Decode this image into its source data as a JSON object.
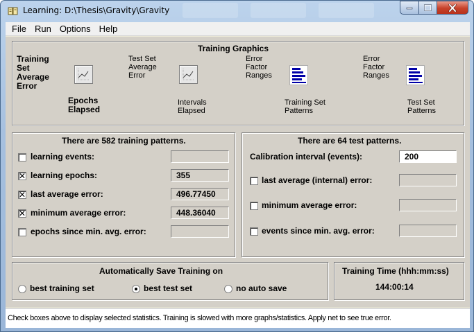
{
  "window": {
    "title": "Learning: D:\\Thesis\\Gravity\\Gravity",
    "icon": "book-icon"
  },
  "menu": [
    "File",
    "Run",
    "Options",
    "Help"
  ],
  "graphics": {
    "title": "Training Graphics",
    "training_set_average_error": {
      "line1": "Training",
      "line2": "Set",
      "line3": "Average",
      "line4": "Error"
    },
    "epochs_elapsed": {
      "line1": "Epochs",
      "line2": "Elapsed"
    },
    "test_set_average_error": {
      "line1": "Test Set",
      "line2": "Average",
      "line3": "Error"
    },
    "intervals_elapsed": {
      "line1": "Intervals",
      "line2": "Elapsed"
    },
    "error_factor_ranges_training": {
      "line1": "Error",
      "line2": "Factor",
      "line3": "Ranges"
    },
    "training_set_patterns": {
      "line1": "Training Set",
      "line2": "Patterns"
    },
    "error_factor_ranges_test": {
      "line1": "Error",
      "line2": "Factor",
      "line3": "Ranges"
    },
    "test_set_patterns": {
      "line1": "Test Set",
      "line2": "Patterns"
    }
  },
  "training": {
    "header": "There are 582 training patterns.",
    "rows": [
      {
        "label": "learning events:",
        "checked": false,
        "value": ""
      },
      {
        "label": "learning epochs:",
        "checked": true,
        "value": "355"
      },
      {
        "label": "last average error:",
        "checked": true,
        "value": "496.77450"
      },
      {
        "label": "minimum average error:",
        "checked": true,
        "value": "448.36040"
      },
      {
        "label": "epochs since min. avg. error:",
        "checked": false,
        "value": ""
      }
    ]
  },
  "test": {
    "header": "There are 64 test patterns.",
    "calibration_label": "Calibration interval (events):",
    "calibration_value": "200",
    "rows": [
      {
        "label": "last average (internal) error:",
        "checked": false,
        "value": ""
      },
      {
        "label": "minimum average error:",
        "checked": false,
        "value": ""
      },
      {
        "label": "events since min. avg. error:",
        "checked": false,
        "value": ""
      }
    ]
  },
  "autosave": {
    "title": "Automatically Save Training on",
    "options": [
      {
        "label": "best training set",
        "selected": false
      },
      {
        "label": "best test set",
        "selected": true
      },
      {
        "label": "no auto save",
        "selected": false
      }
    ]
  },
  "training_time": {
    "title": "Training Time (hhh:mm:ss)",
    "value": "144:00:14"
  },
  "status": "Check boxes above to display selected statistics. Training is slowed with more graphs/statistics. Apply net to see true error."
}
